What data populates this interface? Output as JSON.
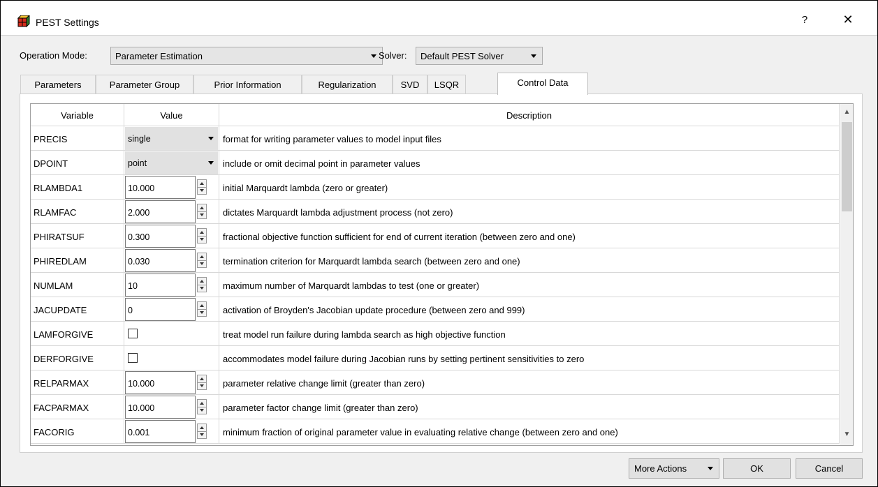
{
  "window": {
    "title": "PEST Settings",
    "help": "?",
    "close": "✕"
  },
  "mode": {
    "label": "Operation Mode:",
    "value": "Parameter Estimation"
  },
  "solver": {
    "label": "Solver:",
    "value": "Default PEST Solver"
  },
  "tabs": [
    "Parameters",
    "Parameter Group",
    "Prior Information",
    "Regularization",
    "SVD",
    "LSQR",
    "Control Data"
  ],
  "active_tab": "Control Data",
  "table": {
    "headers": [
      "Variable",
      "Value",
      "Description"
    ],
    "rows": [
      {
        "variable": "PRECIS",
        "type": "combo",
        "value": "single",
        "description": "format for writing parameter values to model input files"
      },
      {
        "variable": "DPOINT",
        "type": "combo",
        "value": "point",
        "description": "include or omit decimal point in parameter values"
      },
      {
        "variable": "RLAMBDA1",
        "type": "spin",
        "value": "10.000",
        "description": "initial Marquardt lambda (zero or greater)"
      },
      {
        "variable": "RLAMFAC",
        "type": "spin",
        "value": "2.000",
        "description": "dictates Marquardt lambda adjustment process (not zero)"
      },
      {
        "variable": "PHIRATSUF",
        "type": "spin",
        "value": "0.300",
        "description": "fractional objective function sufficient for end of current iteration (between zero and one)"
      },
      {
        "variable": "PHIREDLAM",
        "type": "spin",
        "value": "0.030",
        "description": "termination criterion for Marquardt lambda search (between zero and one)"
      },
      {
        "variable": "NUMLAM",
        "type": "spin",
        "value": "10",
        "description": "maximum number of Marquardt lambdas to test (one or greater)"
      },
      {
        "variable": "JACUPDATE",
        "type": "spin",
        "value": "0",
        "description": "activation of Broyden's Jacobian update procedure (between zero and 999)"
      },
      {
        "variable": "LAMFORGIVE",
        "type": "check",
        "value": "",
        "description": "treat model run failure during lambda search as high objective function"
      },
      {
        "variable": "DERFORGIVE",
        "type": "check",
        "value": "",
        "description": "accommodates model failure during Jacobian runs by setting pertinent sensitivities to zero"
      },
      {
        "variable": "RELPARMAX",
        "type": "spin",
        "value": "10.000",
        "description": "parameter relative change limit (greater than zero)"
      },
      {
        "variable": "FACPARMAX",
        "type": "spin",
        "value": "10.000",
        "description": "parameter factor change limit (greater than zero)"
      },
      {
        "variable": "FACORIG",
        "type": "spin",
        "value": "0.001",
        "description": "minimum fraction of original parameter value in evaluating relative change (between zero and one)"
      }
    ]
  },
  "buttons": {
    "more_actions": "More Actions",
    "ok": "OK",
    "cancel": "Cancel"
  }
}
